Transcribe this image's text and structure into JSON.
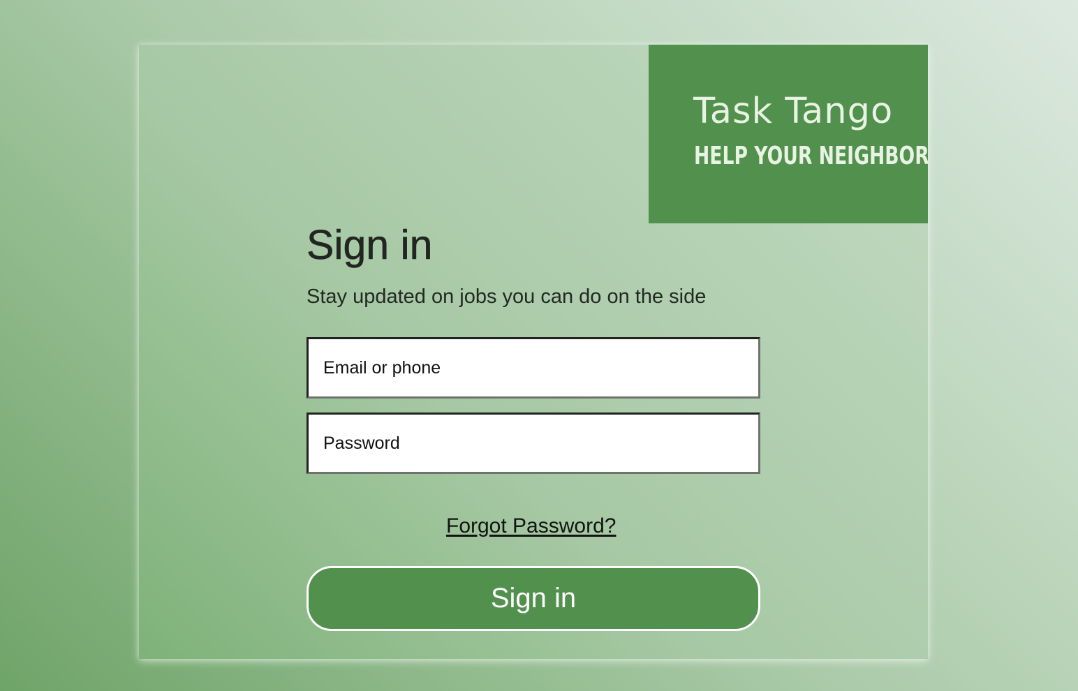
{
  "brand": {
    "name": "Task Tango",
    "tagline": "HELP YOUR NEIGHBOR"
  },
  "signin": {
    "title": "Sign in",
    "subtitle": "Stay updated on jobs you can do on the side",
    "email_placeholder": "Email or phone",
    "password_placeholder": "Password",
    "forgot_label": "Forgot Password?",
    "button_label": "Sign in"
  },
  "colors": {
    "brand_green": "#52904e",
    "input_bg": "#ffffff",
    "text_dark": "#222622"
  }
}
